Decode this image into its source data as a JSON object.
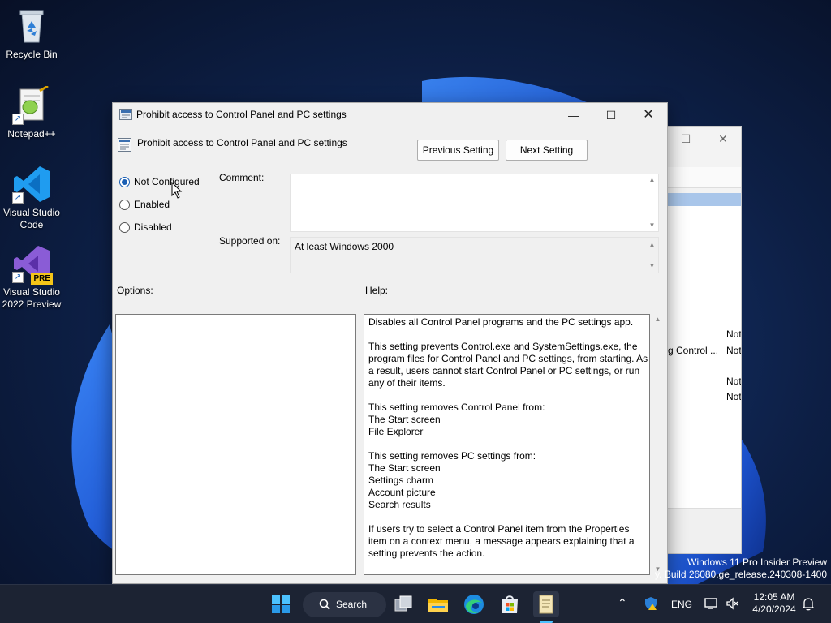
{
  "desktop": {
    "icons": [
      {
        "label": "Recycle Bin",
        "icon": "recycle-bin-icon"
      },
      {
        "label": "Notepad++",
        "icon": "notepad-plus-plus-icon"
      },
      {
        "label": "Visual Studio Code",
        "icon": "vscode-icon"
      },
      {
        "label": "Visual Studio 2022 Preview",
        "icon": "visual-studio-preview-icon",
        "badge": "PRE"
      }
    ]
  },
  "background_window": {
    "rows": [
      {
        "prefix": "Not"
      },
      {
        "prefix": "g Control ...",
        "status": "Not"
      },
      {
        "prefix": "Not"
      },
      {
        "prefix": "Not"
      }
    ]
  },
  "dialog": {
    "title": "Prohibit access to Control Panel and PC settings",
    "setting_name": "Prohibit access to Control Panel and PC settings",
    "buttons": {
      "previous": "Previous Setting",
      "next": "Next Setting"
    },
    "radio_options": [
      {
        "label": "Not Configured",
        "checked": true
      },
      {
        "label": "Enabled",
        "checked": false
      },
      {
        "label": "Disabled",
        "checked": false
      }
    ],
    "comment_label": "Comment:",
    "comment_value": "",
    "supported_label": "Supported on:",
    "supported_value": "At least Windows 2000",
    "options_label": "Options:",
    "help_label": "Help:",
    "help_paragraphs": [
      [
        "Disables all Control Panel programs and the PC settings app."
      ],
      [
        "This setting prevents Control.exe and SystemSettings.exe, the program files for Control Panel and PC settings, from starting. As a result, users cannot start Control Panel or PC settings, or run any of their items."
      ],
      [
        "This setting removes Control Panel from:",
        "The Start screen",
        "File Explorer"
      ],
      [
        "This setting removes PC settings from:",
        "The Start screen",
        "Settings charm",
        "Account picture",
        "Search results"
      ],
      [
        "If users try to select a Control Panel item from the Properties item on a context menu, a message appears explaining that a setting prevents the action."
      ]
    ]
  },
  "watermark": {
    "line1": "Windows 11 Pro Insider Preview",
    "line2": "y. Build 26080.ge_release.240308-1400"
  },
  "taskbar": {
    "search_label": "Search",
    "apps": [
      "start-icon",
      "task-view-icon",
      "file-explorer-icon",
      "edge-icon",
      "store-icon",
      "notepad-icon"
    ],
    "language": "ENG",
    "time": "12:05 AM",
    "date": "4/20/2024"
  },
  "colors": {
    "accent": "#1a5fb4",
    "taskbar": "#1c2333",
    "wallpaper_dark": "#0b1530",
    "bloom_blue": "#1f5fe0"
  }
}
